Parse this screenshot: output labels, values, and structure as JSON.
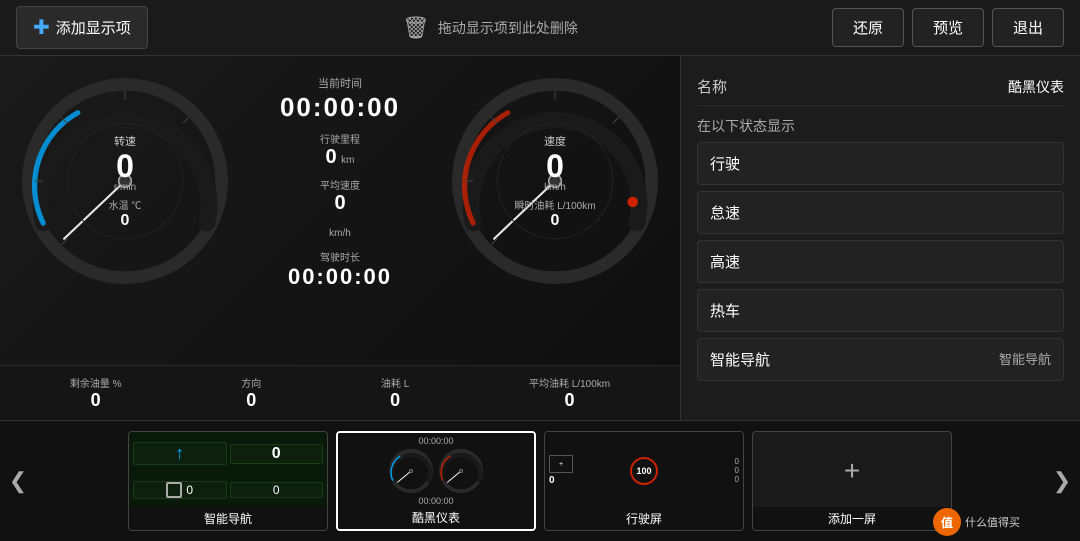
{
  "toolbar": {
    "add_label": "添加显示项",
    "plus_icon": "+",
    "trash_icon": "🗑",
    "delete_hint": "拖动显示项到此处删除",
    "restore_label": "还原",
    "preview_label": "预览",
    "exit_label": "退出"
  },
  "dashboard": {
    "current_time_label": "当前时间",
    "current_time_value": "00:00:00",
    "mileage_label": "行驶里程",
    "mileage_value": "0",
    "mileage_unit": "km",
    "avg_speed_label": "平均速度",
    "avg_speed_value": "0",
    "avg_speed_unit": "km/h",
    "instant_fuel_label": "瞬时油耗 L/100km",
    "instant_fuel_value": "0",
    "drive_time_label": "驾驶时长",
    "drive_time_value": "00:00:00",
    "rpm_label": "转速",
    "rpm_value": "0",
    "rpm_unit": "r/min",
    "water_temp_label": "水温 ℃",
    "water_temp_value": "0",
    "speed_label": "速度",
    "speed_value": "0",
    "speed_unit": "km/h",
    "fuel_remain_label": "剩余油量 %",
    "fuel_remain_value": "0",
    "direction_label": "方向",
    "direction_value": "0",
    "fuel_consume_label": "油耗 L",
    "fuel_consume_value": "0",
    "avg_fuel_label": "平均油耗 L/100km",
    "avg_fuel_value": "0"
  },
  "settings": {
    "name_label": "名称",
    "name_value": "酷黑仪表",
    "show_states_label": "在以下状态显示",
    "states": [
      {
        "label": "行驶",
        "value": ""
      },
      {
        "label": "怠速",
        "value": ""
      },
      {
        "label": "高速",
        "value": ""
      },
      {
        "label": "热车",
        "value": ""
      },
      {
        "label": "智能导航",
        "value": "智能导航"
      }
    ]
  },
  "thumbnails": [
    {
      "label": "智能导航",
      "selected": false,
      "type": "nav"
    },
    {
      "label": "酷黑仪表",
      "selected": true,
      "type": "gauge"
    },
    {
      "label": "行驶屏",
      "selected": false,
      "type": "drive"
    },
    {
      "label": "添加一屏",
      "selected": false,
      "type": "add"
    }
  ],
  "watermark": {
    "logo": "值",
    "text": "什么值得买"
  },
  "icons": {
    "left_arrow": "❮",
    "right_arrow": "❯",
    "up_arrow": "↑",
    "plus": "+"
  }
}
